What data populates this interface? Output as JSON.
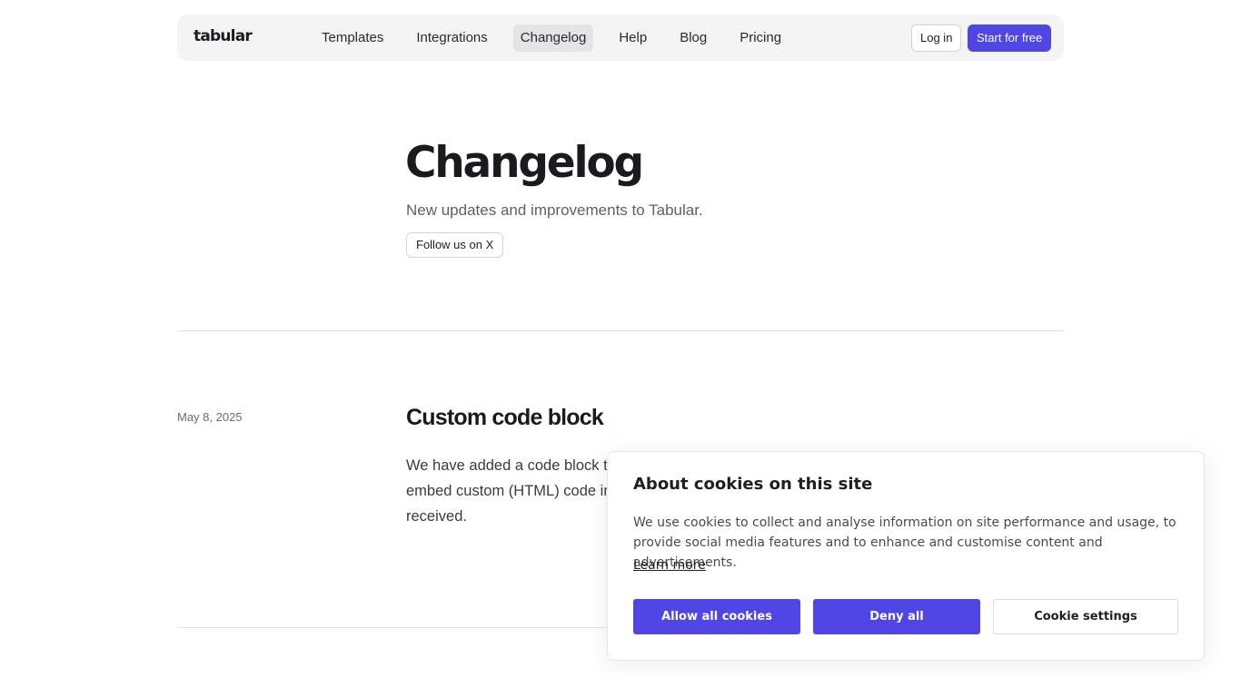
{
  "nav": {
    "logo": "tabular",
    "links": [
      "Templates",
      "Integrations",
      "Changelog",
      "Help",
      "Blog",
      "Pricing"
    ],
    "active": "Changelog",
    "login": "Log in",
    "cta": "Start for free"
  },
  "hero": {
    "title": "Changelog",
    "subtitle": "New updates and improvements to Tabular.",
    "follow": "Follow us on X"
  },
  "entries": [
    {
      "date": "May 8, 2025",
      "title": "Custom code block",
      "body": "We have added a code block to the email editor. You can now drag in and embed custom (HTML) code into emails, or paste custom code that you've received."
    }
  ],
  "cookie": {
    "title": "About cookies on this site",
    "text": "We use cookies to collect and analyse information on site performance and usage, to provide social media features and to enhance and customise content and advertisements.",
    "learn_more": "Learn more",
    "allow": "Allow all cookies",
    "deny": "Deny all",
    "settings": "Cookie settings"
  },
  "colors": {
    "accent": "#4f46e5",
    "nav_bg": "#f4f4f5"
  }
}
